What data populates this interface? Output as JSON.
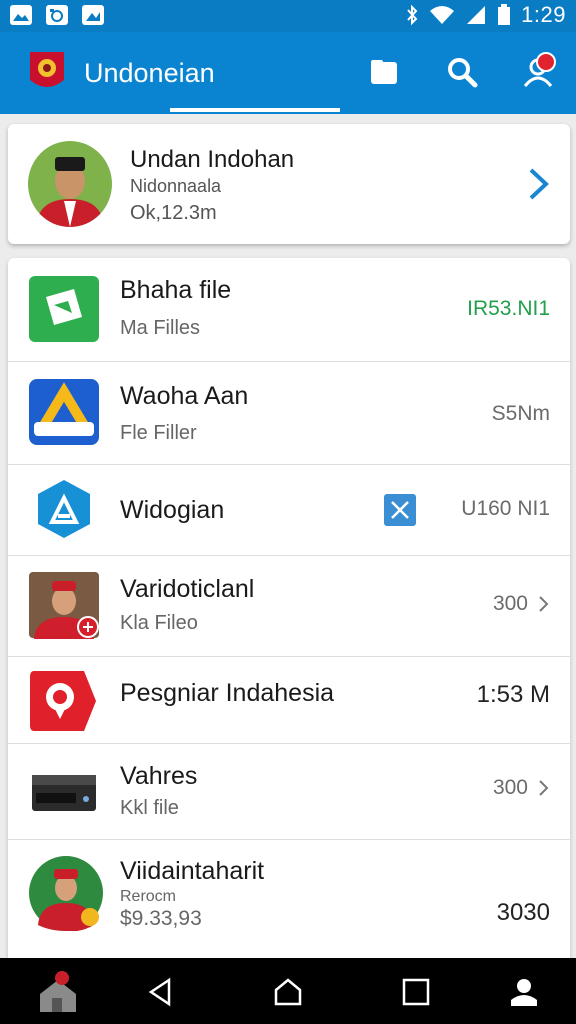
{
  "status_bar": {
    "time": "1:29",
    "icons": [
      "image-icon",
      "photo-icon",
      "gallery-icon",
      "bluetooth-icon",
      "wifi-icon",
      "signal-icon",
      "battery-icon"
    ]
  },
  "app_bar": {
    "title": "Undoneian",
    "actions": [
      "folder-icon",
      "search-icon",
      "account-notification-icon"
    ],
    "colors": {
      "primary": "#0a84d0",
      "status": "#0a7cc4"
    }
  },
  "profile": {
    "name": "Undan Indohan",
    "subtitle": "Nidonnaala",
    "size": "Ok,12.3m"
  },
  "items": [
    {
      "title": "Bhaha file",
      "subtitle": "Ma Filles",
      "value": "IR53.NI1",
      "icon": "green-file-app-icon"
    },
    {
      "title": "Waoha Aan",
      "subtitle": "Fle Filler",
      "value": "S5Nm",
      "icon": "blue-a-app-icon"
    },
    {
      "title": "Widogian",
      "subtitle": "",
      "value": "U160 NI1",
      "icon": "hexagon-app-icon"
    },
    {
      "title": "Varidoticlanl",
      "subtitle": "Kla Fileo",
      "value": "300",
      "icon": "person-thumbnail"
    },
    {
      "title": "Pesgniar Indahesia",
      "subtitle": "",
      "value": "1:53 M",
      "icon": "red-pin-app-icon"
    },
    {
      "title": "Vahres",
      "subtitle": "Kkl file",
      "value": "300",
      "icon": "hard-drive-icon"
    },
    {
      "title": "Viidaintaharit",
      "subtitle": "Rerocm",
      "extra": "$9.33,93",
      "value": "3030",
      "icon": "person-avatar"
    }
  ],
  "nav_bar": [
    "home-icon",
    "back-icon",
    "home-circle-icon",
    "recents-icon",
    "profile-icon"
  ]
}
